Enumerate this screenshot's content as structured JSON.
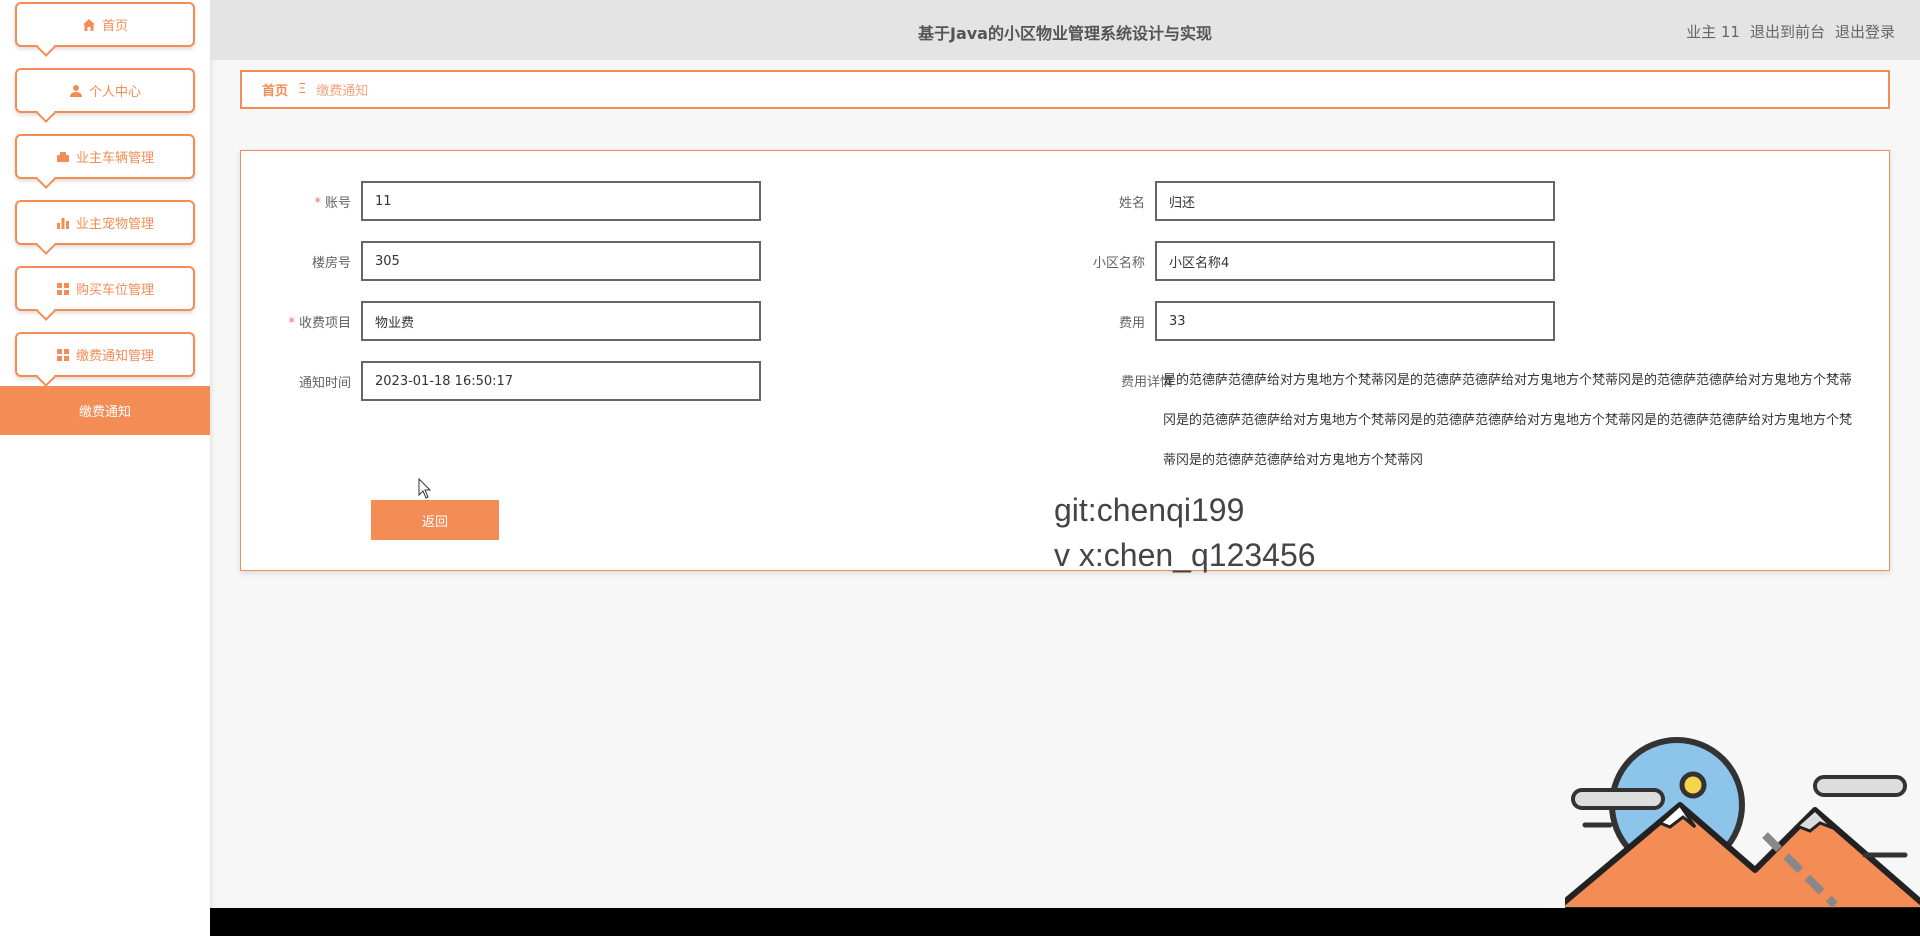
{
  "sidebar": {
    "items": [
      {
        "label": "首页",
        "icon": "home-icon"
      },
      {
        "label": "个人中心",
        "icon": "user-icon"
      },
      {
        "label": "业主车辆管理",
        "icon": "car-icon"
      },
      {
        "label": "业主宠物管理",
        "icon": "bar-chart-icon"
      },
      {
        "label": "购买车位管理",
        "icon": "grid-icon"
      },
      {
        "label": "缴费通知管理",
        "icon": "grid-icon"
      }
    ],
    "active_sub": "缴费通知"
  },
  "header": {
    "title": "基于Java的小区物业管理系统设计与实现",
    "user": "业主 11",
    "front_link": "退出到前台",
    "logout": "退出登录"
  },
  "breadcrumb": {
    "home": "首页",
    "separator": "Ξ",
    "current": "缴费通知"
  },
  "form": {
    "account": {
      "label": "账号",
      "value": "11",
      "required": true
    },
    "name": {
      "label": "姓名",
      "value": "归还"
    },
    "building": {
      "label": "楼房号",
      "value": "305"
    },
    "community": {
      "label": "小区名称",
      "value": "小区名称4"
    },
    "charge_item": {
      "label": "收费项目",
      "value": "物业费",
      "required": true
    },
    "fee": {
      "label": "费用",
      "value": "33"
    },
    "notice_time": {
      "label": "通知时间",
      "value": "2023-01-18 16:50:17"
    },
    "fee_detail": {
      "label": "费用详情",
      "value": "是的范德萨范德萨给对方鬼地方个梵蒂冈是的范德萨范德萨给对方鬼地方个梵蒂冈是的范德萨范德萨给对方鬼地方个梵蒂冈是的范德萨范德萨给对方鬼地方个梵蒂冈是的范德萨范德萨给对方鬼地方个梵蒂冈是的范德萨范德萨给对方鬼地方个梵蒂冈是的范德萨范德萨给对方鬼地方个梵蒂冈"
    },
    "back_label": "返回"
  },
  "watermark": {
    "line1": "git:chenqi199",
    "line2": "v x:chen_q123456"
  },
  "colors": {
    "accent": "#f48d55",
    "header_bg": "#e4e4e4"
  }
}
